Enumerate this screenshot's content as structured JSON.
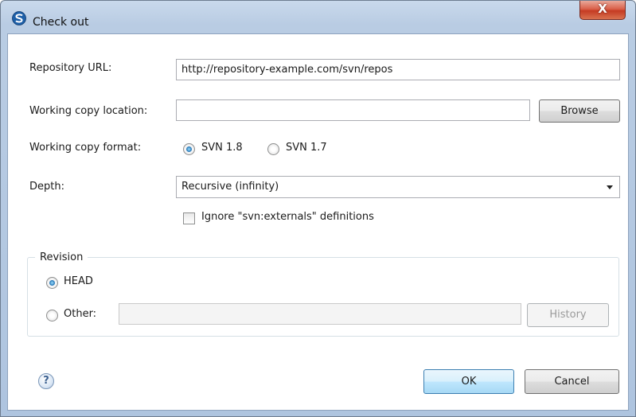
{
  "window": {
    "title": "Check out",
    "close_label": "X"
  },
  "repository_url": {
    "label": "Repository URL:",
    "value": "http://repository-example.com/svn/repos"
  },
  "working_copy_location": {
    "label": "Working copy location:",
    "value": "",
    "browse_label": "Browse"
  },
  "working_copy_format": {
    "label": "Working copy format:",
    "options": [
      {
        "label": "SVN 1.8",
        "selected": true
      },
      {
        "label": "SVN 1.7",
        "selected": false
      }
    ]
  },
  "depth": {
    "label": "Depth:",
    "selected": "Recursive (infinity)"
  },
  "ignore_externals": {
    "label": "Ignore \"svn:externals\" definitions",
    "checked": false
  },
  "revision": {
    "title": "Revision",
    "head_label": "HEAD",
    "other_label": "Other:",
    "other_value": "",
    "history_label": "History",
    "selected": "HEAD"
  },
  "footer": {
    "help_label": "?",
    "ok_label": "OK",
    "cancel_label": "Cancel"
  }
}
